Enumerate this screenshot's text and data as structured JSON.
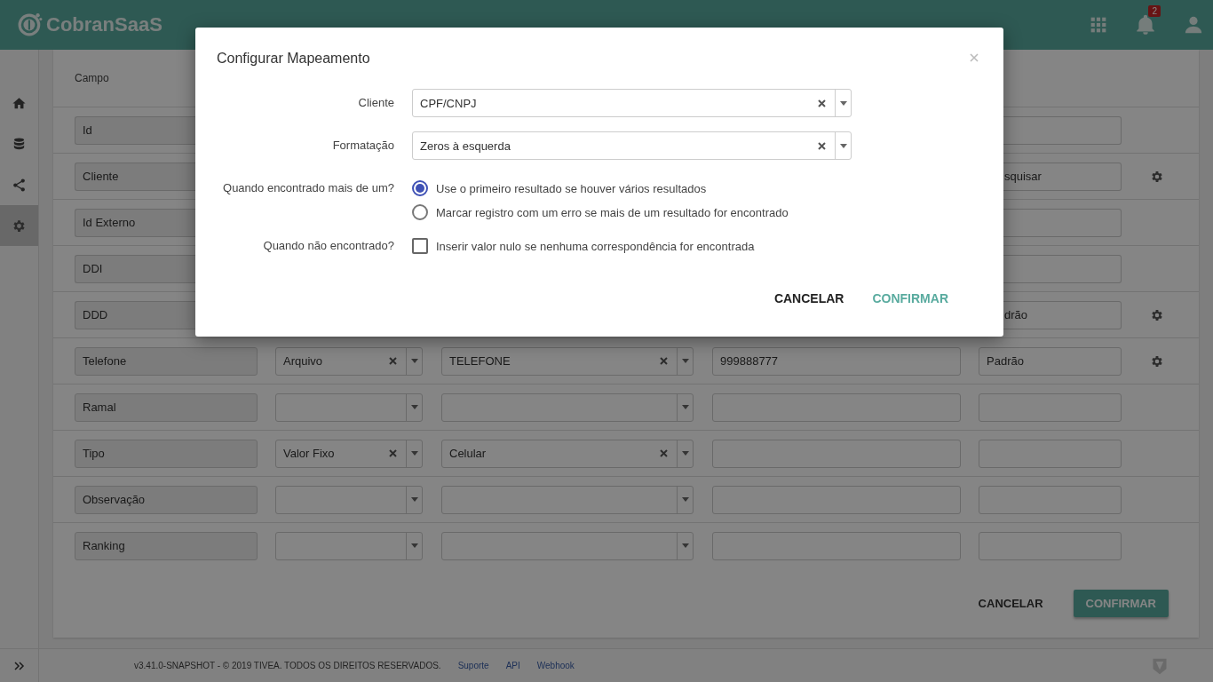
{
  "header": {
    "logo": "CobranSaaS",
    "notification_count": "2"
  },
  "sidebar": {
    "items": [
      {
        "selected": false
      },
      {
        "selected": false
      },
      {
        "selected": false
      },
      {
        "selected": true
      }
    ]
  },
  "table": {
    "columns": [
      "Campo"
    ],
    "rows": [
      {
        "field": "Id",
        "settings": false
      },
      {
        "field": "Cliente",
        "column_5": "squisar",
        "settings": true
      },
      {
        "field": "Id Externo",
        "settings": false
      },
      {
        "field": "DDI",
        "settings": false
      },
      {
        "field": "DDD",
        "column_5": "drão",
        "settings": true
      },
      {
        "field": "Telefone",
        "source": {
          "value": "Arquivo",
          "clearable": true
        },
        "mapping": {
          "kind": "select",
          "value": "TELEFONE",
          "clearable": true
        },
        "column_4": "999888777",
        "column_5": "Padrão",
        "settings": true
      },
      {
        "field": "Ramal",
        "source": {
          "clearable": false
        },
        "mapping": {
          "kind": "select",
          "clearable": false
        },
        "settings": false
      },
      {
        "field": "Tipo",
        "source": {
          "value": "Valor Fixo",
          "clearable": true
        },
        "mapping": {
          "kind": "select",
          "value": "Celular",
          "clearable": true
        },
        "settings": false
      },
      {
        "field": "Observação",
        "source": {
          "clearable": false
        },
        "mapping": {
          "kind": "select",
          "clearable": false
        },
        "settings": false
      },
      {
        "field": "Ranking",
        "source": {
          "clearable": false
        },
        "mapping": {
          "kind": "select",
          "clearable": false
        },
        "settings": false
      }
    ],
    "buttons": [
      "CANCELAR",
      "CONFIRMAR"
    ]
  },
  "footer": {
    "text": "v3.41.0-SNAPSHOT - © 2019 TIVEA. TODOS OS DIREITOS RESERVADOS.",
    "links": [
      "Suporte",
      "API",
      "Webhook"
    ]
  },
  "modal": {
    "title": "Configurar Mapeamento",
    "fields": [
      {
        "label": "Cliente",
        "value": "CPF/CNPJ",
        "clearable": true
      },
      {
        "label": "Formatação",
        "value": "Zeros à esquerda",
        "clearable": true
      }
    ],
    "radio_group": {
      "label": "Quando encontrado mais de um?",
      "options": [
        {
          "label": "Use o primeiro resultado se houver vários resultados",
          "selected": true
        },
        {
          "label": "Marcar registro com um erro se mais de um resultado for encontrado",
          "selected": false
        }
      ]
    },
    "checkbox": {
      "label": "Quando não encontrado?",
      "text": "Inserir valor nulo se nenhuma correspondência for encontrada",
      "checked": false
    },
    "buttons": [
      "CANCELAR",
      "CONFIRMAR"
    ]
  }
}
